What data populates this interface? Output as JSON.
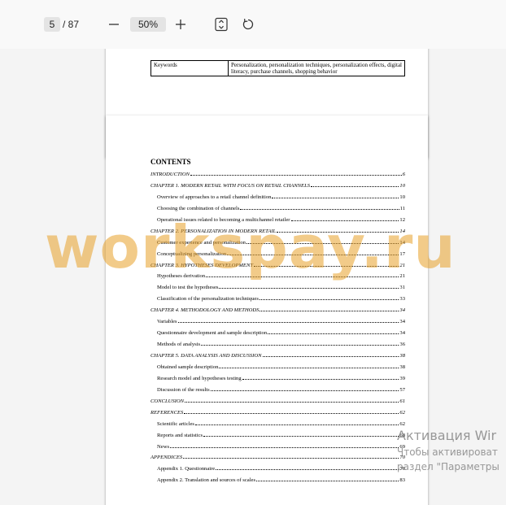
{
  "toolbar": {
    "current_page": "5",
    "total_pages": "/ 87",
    "zoom_out_icon": "minus-icon",
    "zoom_level": "50%",
    "zoom_in_icon": "plus-icon",
    "fit_icon": "fit-page-icon",
    "rotate_icon": "rotate-icon"
  },
  "prev_page": {
    "keywords_label": "Keywords",
    "keywords_value": "Personalization, personalization techniques, personalization effects, digital literacy, purchase channels, shopping behavior",
    "page_number": "4"
  },
  "current_page": {
    "heading": "CONTENTS",
    "toc": [
      {
        "title": "INTRODUCTION",
        "page": "6",
        "level": "ch"
      },
      {
        "title": "CHAPTER 1. MODERN RETAIL WITH FOCUS ON RETAIL CHANNELS",
        "page": "10",
        "level": "ch"
      },
      {
        "title": "Overview of approaches to a retail channel definition",
        "page": "10",
        "level": "sub"
      },
      {
        "title": "Choosing the combination of channels",
        "page": "11",
        "level": "sub"
      },
      {
        "title": "Operational issues related to becoming a multichannel retailer",
        "page": "12",
        "level": "sub"
      },
      {
        "title": "CHAPTER 2. PERSONALIZATION IN MODERN RETAIL",
        "page": "14",
        "level": "ch"
      },
      {
        "title": "Customer experience and personalization",
        "page": "14",
        "level": "sub"
      },
      {
        "title": "Conceptualizing personalization",
        "page": "17",
        "level": "sub"
      },
      {
        "title": "CHAPTER 3. HYPOTHESES DEVELOPMENT",
        "page": "21",
        "level": "ch"
      },
      {
        "title": "Hypotheses derivation",
        "page": "21",
        "level": "sub"
      },
      {
        "title": "Model to test the hypotheses",
        "page": "31",
        "level": "sub"
      },
      {
        "title": "Classification of the personalization techniques",
        "page": "33",
        "level": "sub"
      },
      {
        "title": "CHAPTER 4. METHODOLOGY AND METHODS",
        "page": "34",
        "level": "ch"
      },
      {
        "title": "Variables",
        "page": "34",
        "level": "sub"
      },
      {
        "title": "Questionnaire development and sample description",
        "page": "34",
        "level": "sub"
      },
      {
        "title": "Methods of analysis",
        "page": "36",
        "level": "sub"
      },
      {
        "title": "CHAPTER 5. DATA ANALYSIS AND DISCUSSION",
        "page": "38",
        "level": "ch"
      },
      {
        "title": "Obtained sample description",
        "page": "38",
        "level": "sub"
      },
      {
        "title": "Research model and hypotheses testing",
        "page": "39",
        "level": "sub"
      },
      {
        "title": "Discussion of the results",
        "page": "57",
        "level": "sub"
      },
      {
        "title": "CONCLUSION",
        "page": "61",
        "level": "ch"
      },
      {
        "title": "REFERENCES",
        "page": "62",
        "level": "ch"
      },
      {
        "title": "Scientific articles",
        "page": "62",
        "level": "sub"
      },
      {
        "title": "Reports and statistics",
        "page": "68",
        "level": "sub"
      },
      {
        "title": "News",
        "page": "69",
        "level": "sub"
      },
      {
        "title": "APPENDICES",
        "page": "70",
        "level": "ch"
      },
      {
        "title": "Appendix 1. Questionnaire",
        "page": "70",
        "level": "sub"
      },
      {
        "title": "Appendix 2. Translation and sources of scales",
        "page": "83",
        "level": "sub"
      }
    ]
  },
  "watermark": "workspay.ru",
  "activation_notice": {
    "line1": "Активация Wir",
    "line2": "Чтобы активироват",
    "line3": "раздел \"Параметры"
  },
  "colors": {
    "toolbar_bg": "#f9f9f9",
    "viewer_bg": "#f4f4f4",
    "watermark": "#e8a028"
  }
}
